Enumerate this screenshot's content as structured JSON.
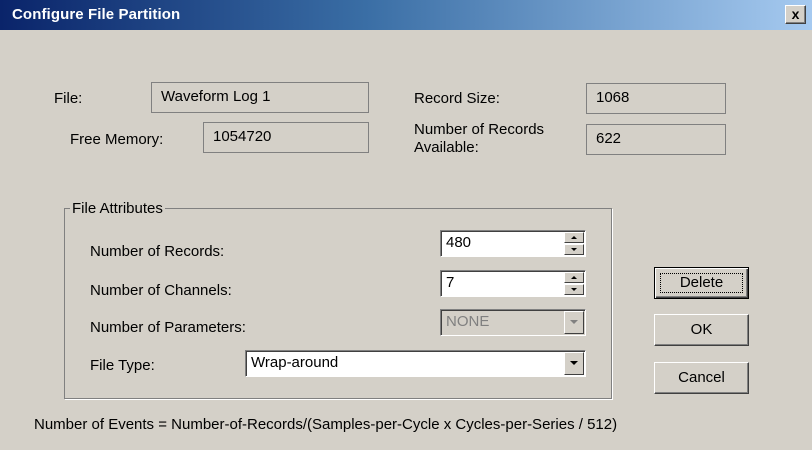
{
  "window": {
    "title": "Configure File Partition",
    "close_label": "x"
  },
  "info": {
    "file_label": "File:",
    "file_value": "Waveform Log 1",
    "free_memory_label": "Free Memory:",
    "free_memory_value": "1054720",
    "record_size_label": "Record Size:",
    "record_size_value": "1068",
    "records_available_label": "Number of Records Available:",
    "records_available_value": "622"
  },
  "file_attributes": {
    "group_label": "File Attributes",
    "num_records_label": "Number of Records:",
    "num_records_value": "480",
    "num_channels_label": "Number of Channels:",
    "num_channels_value": "7",
    "num_parameters_label": "Number of Parameters:",
    "num_parameters_value": "NONE",
    "file_type_label": "File Type:",
    "file_type_value": "Wrap-around"
  },
  "buttons": {
    "delete_label": "Delete",
    "ok_label": "OK",
    "cancel_label": "Cancel"
  },
  "footer": {
    "formula": "Number of Events = Number-of-Records/(Samples-per-Cycle x Cycles-per-Series / 512)"
  },
  "colors": {
    "face": "#d4d0c8",
    "title_start": "#0a246a",
    "title_end": "#a6caf0",
    "disabled_text": "#808080"
  }
}
